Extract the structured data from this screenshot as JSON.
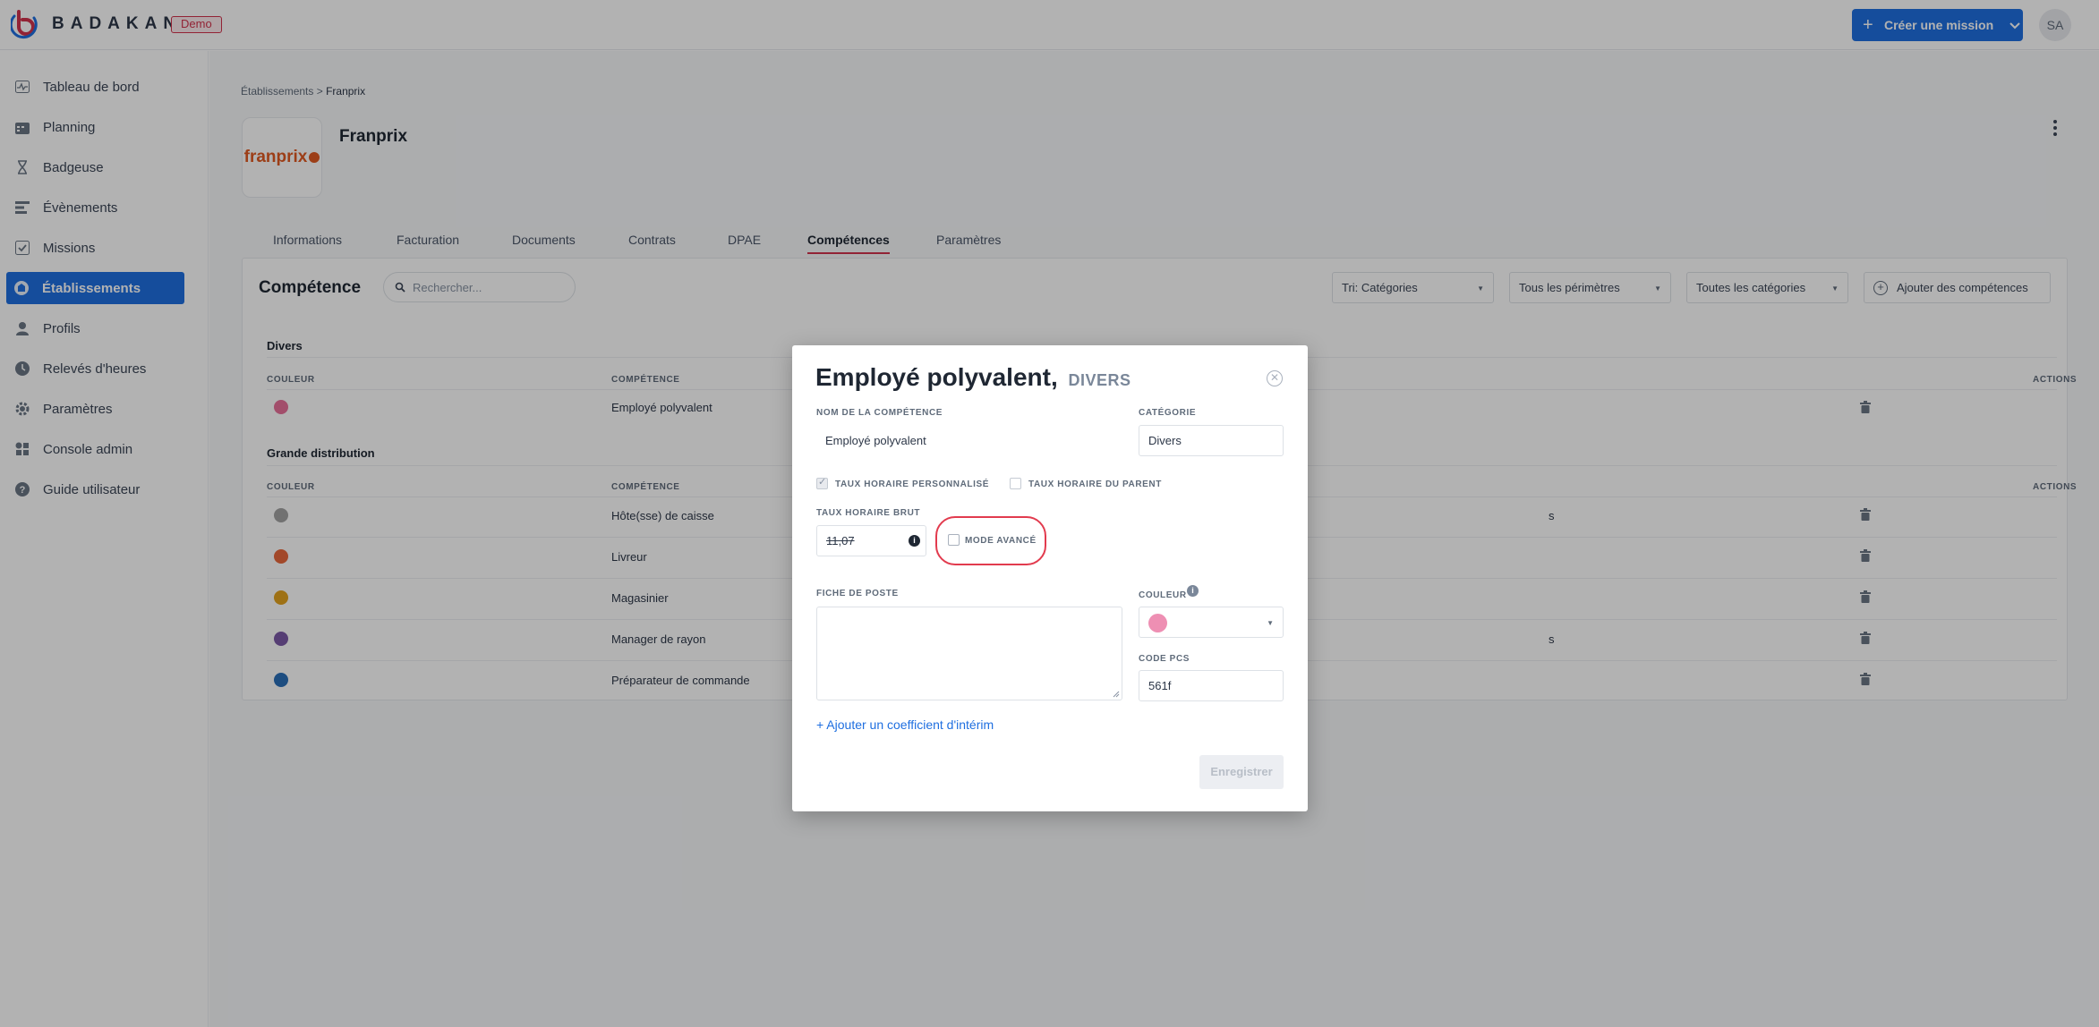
{
  "topbar": {
    "brand": "BADAKAN",
    "demo_badge": "Demo",
    "create_button": "Créer une mission",
    "avatar_initials": "SA",
    "accent_color": "#1f6fe0"
  },
  "sidebar": {
    "items": [
      {
        "label": "Tableau de bord",
        "icon": "pulse-icon"
      },
      {
        "label": "Planning",
        "icon": "calendar-icon"
      },
      {
        "label": "Badgeuse",
        "icon": "hourglass-icon"
      },
      {
        "label": "Évènements",
        "icon": "list-icon"
      },
      {
        "label": "Missions",
        "icon": "check-square-icon"
      },
      {
        "label": "Établissements",
        "icon": "building-icon",
        "active": true
      },
      {
        "label": "Profils",
        "icon": "user-icon"
      },
      {
        "label": "Relevés d'heures",
        "icon": "clock-icon"
      },
      {
        "label": "Paramètres",
        "icon": "gear-icon"
      },
      {
        "label": "Console admin",
        "icon": "grid-icon"
      },
      {
        "label": "Guide utilisateur",
        "icon": "question-icon"
      }
    ]
  },
  "breadcrumb": {
    "parent": "Établissements",
    "separator": ">",
    "current": "Franprix"
  },
  "establishment": {
    "name": "Franprix",
    "logo_text": "franprix"
  },
  "tabs": [
    {
      "label": "Informations"
    },
    {
      "label": "Facturation"
    },
    {
      "label": "Documents"
    },
    {
      "label": "Contrats"
    },
    {
      "label": "DPAE"
    },
    {
      "label": "Compétences",
      "active": true
    },
    {
      "label": "Paramètres"
    }
  ],
  "competences": {
    "title": "Compétence",
    "search_placeholder": "Rechercher...",
    "sort_select": "Tri: Catégories",
    "perimeter_select": "Tous les périmètres",
    "category_select": "Toutes les catégories",
    "add_button": "Ajouter des compétences",
    "col_color": "COULEUR",
    "col_competence": "COMPÉTENCE",
    "col_actions": "ACTIONS",
    "groups": [
      {
        "name": "Divers",
        "rows": [
          {
            "name": "Employé polyvalent",
            "color": "#e8709a"
          }
        ]
      },
      {
        "name": "Grande distribution",
        "rows": [
          {
            "name": "Hôte(sse) de caisse",
            "color": "#a3a3a3",
            "extra": "s"
          },
          {
            "name": "Livreur",
            "color": "#e8673c"
          },
          {
            "name": "Magasinier",
            "color": "#e3a21f"
          },
          {
            "name": "Manager de rayon",
            "color": "#7b5aa6",
            "extra": "s"
          },
          {
            "name": "Préparateur de commande",
            "color": "#2a6fb8"
          }
        ]
      }
    ]
  },
  "modal": {
    "title": "Employé polyvalent,",
    "subtitle": "DIVERS",
    "name_label": "NOM DE LA COMPÉTENCE",
    "name_value": "Employé polyvalent",
    "category_label": "CATÉGORIE",
    "category_value": "Divers",
    "custom_rate_label": "TAUX HORAIRE PERSONNALISÉ",
    "custom_rate_checked": true,
    "parent_rate_label": "TAUX HORAIRE DU PARENT",
    "parent_rate_checked": false,
    "gross_rate_label": "TAUX HORAIRE BRUT",
    "gross_rate_value": "11,07",
    "advanced_mode_label": "MODE AVANCÉ",
    "advanced_mode_checked": false,
    "job_sheet_label": "FICHE DE POSTE",
    "job_sheet_value": "",
    "color_label": "COULEUR",
    "color_value": "#ee8fb3",
    "pcs_label": "CODE PCS",
    "pcs_value": "561f",
    "add_coef_link": "+ Ajouter un coefficient d'intérim",
    "save_button": "Enregistrer"
  }
}
